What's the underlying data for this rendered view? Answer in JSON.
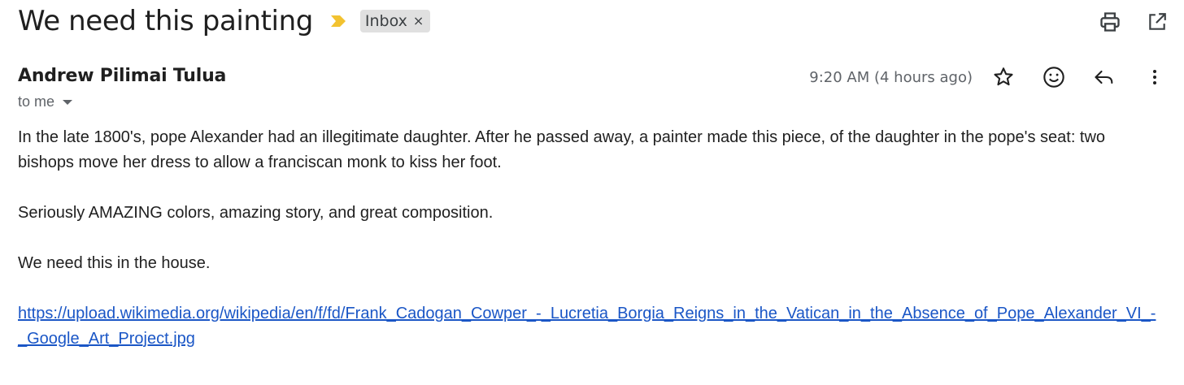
{
  "email": {
    "subject": "We need this painting",
    "label": "Inbox",
    "label_close": "×",
    "sender": "Andrew Pilimai Tulua",
    "recipients": "to me",
    "timestamp": "9:20 AM (4 hours ago)",
    "body": {
      "paragraph1": "In the late 1800's, pope Alexander had an illegitimate daughter. After he passed away, a painter made this piece, of the daughter in the pope's seat: two bishops move her dress to allow a franciscan monk to kiss her foot.",
      "paragraph2": "Seriously AMAZING colors, amazing story, and great composition.",
      "paragraph3": "We need this in the house.",
      "link": "https://upload.wikimedia.org/wikipedia/en/f/fd/Frank_Cadogan_Cowper_-_Lucretia_Borgia_Reigns_in_the_Vatican_in_the_Absence_of_Pope_Alexander_VI_-_Google_Art_Project.jpg"
    }
  },
  "icons": {
    "importance": "importance-marker-icon",
    "print": "print-icon",
    "open_new_window": "open-in-new-window-icon",
    "star": "star-icon",
    "emoji": "emoji-reaction-icon",
    "reply": "reply-icon",
    "more": "more-vertical-icon"
  },
  "colors": {
    "importance_marker": "#f2c230",
    "link": "#1a56c6",
    "label_chip_bg": "#e0e0e0",
    "secondary_text": "#5f6368"
  }
}
